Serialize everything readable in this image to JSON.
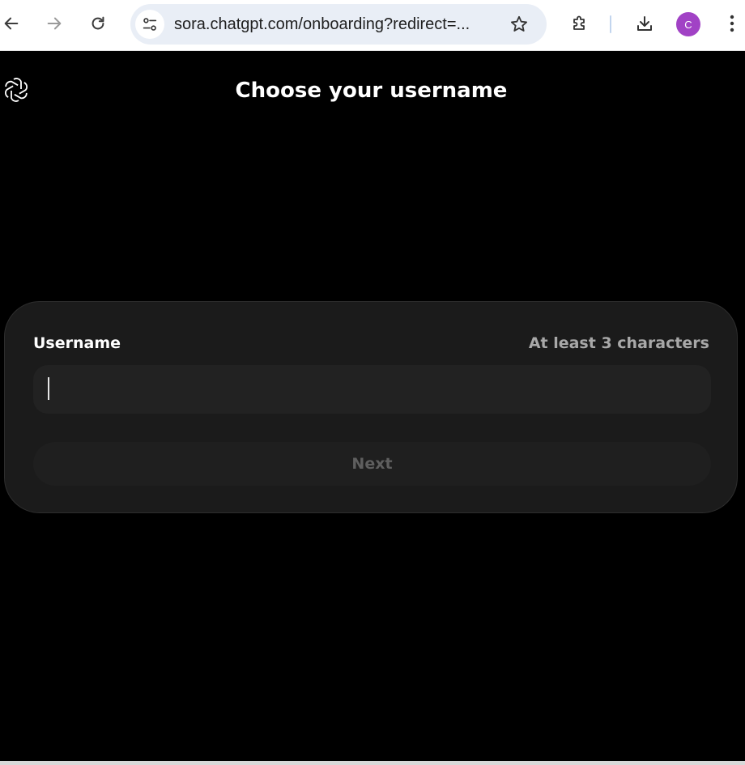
{
  "browser": {
    "url": "sora.chatgpt.com/onboarding?redirect=...",
    "profile_initial": "C",
    "profile_color": "#a142c5",
    "icons": {
      "back": "back-arrow-icon",
      "forward": "forward-arrow-icon",
      "reload": "reload-icon",
      "site_info": "tune-icon",
      "bookmark": "star-icon",
      "extensions": "puzzle-icon",
      "downloads": "download-icon",
      "menu": "kebab-menu-icon"
    }
  },
  "page": {
    "logo": "openai-logo",
    "title": "Choose your username",
    "form": {
      "label": "Username",
      "hint": "At least 3 characters",
      "input_value": "",
      "next_label": "Next"
    }
  },
  "colors": {
    "background": "#000000",
    "card": "#1b1b1b",
    "input": "#222222",
    "button_disabled_text": "#5f5f5f"
  }
}
